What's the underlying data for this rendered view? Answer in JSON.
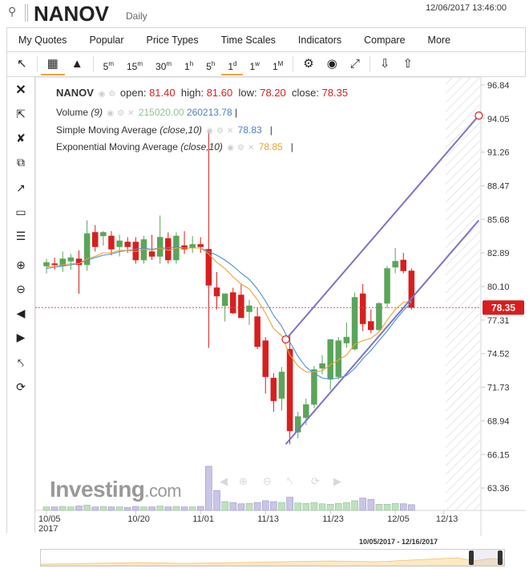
{
  "header": {
    "symbol": "NANOV",
    "interval": "Daily",
    "datetime": "12/06/2017 13:46:00"
  },
  "menu": [
    "My Quotes",
    "Popular",
    "Price Types",
    "Time Scales",
    "Indicators",
    "Compare",
    "More"
  ],
  "toolbar": {
    "timeframes": [
      {
        "main": "5",
        "sup": "m"
      },
      {
        "main": "15",
        "sup": "m"
      },
      {
        "main": "30",
        "sup": "m"
      },
      {
        "main": "1",
        "sup": "h"
      },
      {
        "main": "5",
        "sup": "h"
      },
      {
        "main": "1",
        "sup": "d"
      },
      {
        "main": "1",
        "sup": "w"
      },
      {
        "main": "1",
        "sup": "M"
      }
    ],
    "active_timeframe": "1d"
  },
  "legend": {
    "symbol": "NANOV",
    "open_label": "open:",
    "open": "81.40",
    "high_label": "high:",
    "high": "81.60",
    "low_label": "low:",
    "low": "78.20",
    "close_label": "close:",
    "close": "78.35",
    "volume_label": "Volume",
    "volume_param": "(9)",
    "volume_value": "215020.00",
    "volume_ma": "260213.78",
    "sma_label": "Simple Moving Average",
    "sma_param": "(close,10)",
    "sma_value": "78.83",
    "ema_label": "Exponential Moving Average",
    "ema_param": "(close,10)",
    "ema_value": "78.85"
  },
  "logo": {
    "brand": "Investing",
    "suffix": ".com"
  },
  "navigator": {
    "range": "10/05/2017 - 12/16/2017"
  },
  "chart_data": {
    "type": "candlestick",
    "y_ticks": [
      "96.84",
      "94.05",
      "91.26",
      "88.47",
      "85.68",
      "82.89",
      "80.10",
      "77.31",
      "74.52",
      "71.73",
      "68.94",
      "66.15",
      "63.36"
    ],
    "ylim": [
      61.5,
      97.5
    ],
    "x_ticks": [
      {
        "label": "10/05",
        "label2": "2017",
        "index": 0
      },
      {
        "label": "10/20",
        "index": 11
      },
      {
        "label": "11/01",
        "index": 19
      },
      {
        "label": "11/13",
        "index": 27
      },
      {
        "label": "11/23",
        "index": 35
      },
      {
        "label": "12/05",
        "index": 43
      },
      {
        "label": "12/13",
        "index": 49
      }
    ],
    "current_price": 78.35,
    "candles": [
      {
        "o": 81.8,
        "h": 82.4,
        "l": 81.2,
        "c": 82.1
      },
      {
        "o": 82.0,
        "h": 82.5,
        "l": 81.5,
        "c": 81.9
      },
      {
        "o": 81.8,
        "h": 83.0,
        "l": 81.3,
        "c": 82.4
      },
      {
        "o": 82.2,
        "h": 82.8,
        "l": 81.5,
        "c": 82.5
      },
      {
        "o": 82.4,
        "h": 83.1,
        "l": 79.5,
        "c": 81.9
      },
      {
        "o": 81.9,
        "h": 85.6,
        "l": 81.4,
        "c": 84.5
      },
      {
        "o": 84.6,
        "h": 85.2,
        "l": 83.0,
        "c": 83.4
      },
      {
        "o": 84.3,
        "h": 84.7,
        "l": 83.5,
        "c": 84.6
      },
      {
        "o": 84.3,
        "h": 84.7,
        "l": 82.7,
        "c": 83.2
      },
      {
        "o": 83.4,
        "h": 84.4,
        "l": 82.6,
        "c": 83.9
      },
      {
        "o": 83.8,
        "h": 84.2,
        "l": 82.9,
        "c": 83.4
      },
      {
        "o": 83.8,
        "h": 84.2,
        "l": 82.0,
        "c": 82.3
      },
      {
        "o": 82.3,
        "h": 84.3,
        "l": 82.0,
        "c": 84.0
      },
      {
        "o": 83.0,
        "h": 84.4,
        "l": 82.3,
        "c": 82.6
      },
      {
        "o": 82.6,
        "h": 86.0,
        "l": 82.0,
        "c": 84.2
      },
      {
        "o": 84.1,
        "h": 84.6,
        "l": 82.0,
        "c": 82.3
      },
      {
        "o": 82.3,
        "h": 84.6,
        "l": 82.0,
        "c": 84.3
      },
      {
        "o": 83.5,
        "h": 84.7,
        "l": 82.8,
        "c": 83.2
      },
      {
        "o": 83.3,
        "h": 84.3,
        "l": 82.9,
        "c": 83.6
      },
      {
        "o": 83.6,
        "h": 84.2,
        "l": 82.9,
        "c": 83.4
      },
      {
        "o": 83.2,
        "h": 93.0,
        "l": 75.0,
        "c": 80.2
      },
      {
        "o": 80.0,
        "h": 81.3,
        "l": 78.2,
        "c": 79.3
      },
      {
        "o": 78.5,
        "h": 79.5,
        "l": 77.2,
        "c": 79.5
      },
      {
        "o": 79.6,
        "h": 80.0,
        "l": 77.8,
        "c": 77.9
      },
      {
        "o": 79.4,
        "h": 80.3,
        "l": 77.5,
        "c": 77.5
      },
      {
        "o": 78.0,
        "h": 79.0,
        "l": 76.9,
        "c": 78.5
      },
      {
        "o": 77.6,
        "h": 78.3,
        "l": 74.9,
        "c": 75.1
      },
      {
        "o": 75.6,
        "h": 75.9,
        "l": 71.2,
        "c": 72.6
      },
      {
        "o": 72.5,
        "h": 72.9,
        "l": 69.7,
        "c": 70.6
      },
      {
        "o": 70.8,
        "h": 73.4,
        "l": 69.8,
        "c": 73.0
      },
      {
        "o": 74.9,
        "h": 76.1,
        "l": 67.0,
        "c": 68.1
      },
      {
        "o": 68.0,
        "h": 69.7,
        "l": 67.5,
        "c": 69.3
      },
      {
        "o": 69.2,
        "h": 70.8,
        "l": 68.6,
        "c": 70.3
      },
      {
        "o": 70.3,
        "h": 73.5,
        "l": 70.0,
        "c": 73.2
      },
      {
        "o": 73.3,
        "h": 74.4,
        "l": 72.8,
        "c": 73.7
      },
      {
        "o": 72.4,
        "h": 73.8,
        "l": 71.5,
        "c": 75.7
      },
      {
        "o": 72.6,
        "h": 75.9,
        "l": 72.4,
        "c": 75.6
      },
      {
        "o": 75.4,
        "h": 77.1,
        "l": 75.0,
        "c": 75.9
      },
      {
        "o": 74.9,
        "h": 79.6,
        "l": 74.8,
        "c": 79.2
      },
      {
        "o": 79.5,
        "h": 80.3,
        "l": 76.4,
        "c": 77.0
      },
      {
        "o": 77.2,
        "h": 78.2,
        "l": 76.2,
        "c": 76.5
      },
      {
        "o": 76.5,
        "h": 78.8,
        "l": 76.4,
        "c": 78.7
      },
      {
        "o": 78.7,
        "h": 81.8,
        "l": 78.3,
        "c": 81.6
      },
      {
        "o": 81.7,
        "h": 83.3,
        "l": 81.2,
        "c": 82.2
      },
      {
        "o": 82.3,
        "h": 82.9,
        "l": 81.2,
        "c": 81.4
      },
      {
        "o": 81.4,
        "h": 81.6,
        "l": 78.2,
        "c": 78.35
      }
    ],
    "sma": [
      81.6,
      81.7,
      81.8,
      81.9,
      82.0,
      82.3,
      82.5,
      82.7,
      82.8,
      83.0,
      83.1,
      83.2,
      83.3,
      83.2,
      83.3,
      83.3,
      83.4,
      83.3,
      83.3,
      83.3,
      83.0,
      82.7,
      82.3,
      81.8,
      81.2,
      80.7,
      79.9,
      78.9,
      77.7,
      76.8,
      75.5,
      74.3,
      73.4,
      72.9,
      72.5,
      72.4,
      72.5,
      72.7,
      73.3,
      74.1,
      74.8,
      75.6,
      76.4,
      77.3,
      78.1,
      78.8
    ],
    "ema": [
      81.7,
      81.8,
      81.9,
      82.0,
      82.0,
      82.4,
      82.6,
      82.9,
      82.9,
      83.1,
      83.1,
      83.0,
      83.2,
      83.1,
      83.3,
      83.1,
      83.3,
      83.3,
      83.3,
      83.3,
      82.8,
      82.1,
      81.6,
      80.9,
      80.3,
      79.9,
      79.0,
      77.9,
      76.6,
      76.0,
      74.4,
      73.5,
      73.0,
      73.0,
      73.1,
      73.6,
      74.0,
      74.4,
      75.3,
      75.6,
      75.8,
      76.3,
      77.3,
      78.2,
      78.8,
      78.85
    ],
    "volume_scale_max": 100,
    "volume": [
      8,
      8,
      9,
      8,
      10,
      12,
      8,
      9,
      8,
      8,
      7,
      9,
      8,
      8,
      10,
      8,
      9,
      8,
      8,
      9,
      100,
      45,
      20,
      18,
      15,
      16,
      18,
      22,
      20,
      18,
      30,
      17,
      16,
      18,
      15,
      14,
      16,
      18,
      22,
      28,
      25,
      14,
      14,
      16,
      15,
      13
    ],
    "volume_up": [
      true,
      false,
      true,
      true,
      false,
      true,
      false,
      true,
      false,
      true,
      false,
      false,
      true,
      false,
      true,
      false,
      true,
      false,
      true,
      false,
      false,
      false,
      true,
      false,
      false,
      true,
      false,
      false,
      false,
      true,
      false,
      true,
      true,
      true,
      true,
      true,
      true,
      true,
      true,
      false,
      false,
      true,
      true,
      true,
      false,
      false
    ],
    "channel": {
      "upper": [
        {
          "i": 29.5,
          "v": 75.7
        },
        {
          "i": 53.3,
          "v": 94.3
        }
      ],
      "lower": [
        {
          "i": 29.5,
          "v": 67.0
        },
        {
          "i": 53.3,
          "v": 85.6
        }
      ]
    },
    "colors": {
      "up": "#5aa55a",
      "down": "#d81e1e",
      "sma": "#4a90d9",
      "ema": "#f0a030",
      "channel": "#7b74c5",
      "price_line": "#e05050"
    }
  }
}
